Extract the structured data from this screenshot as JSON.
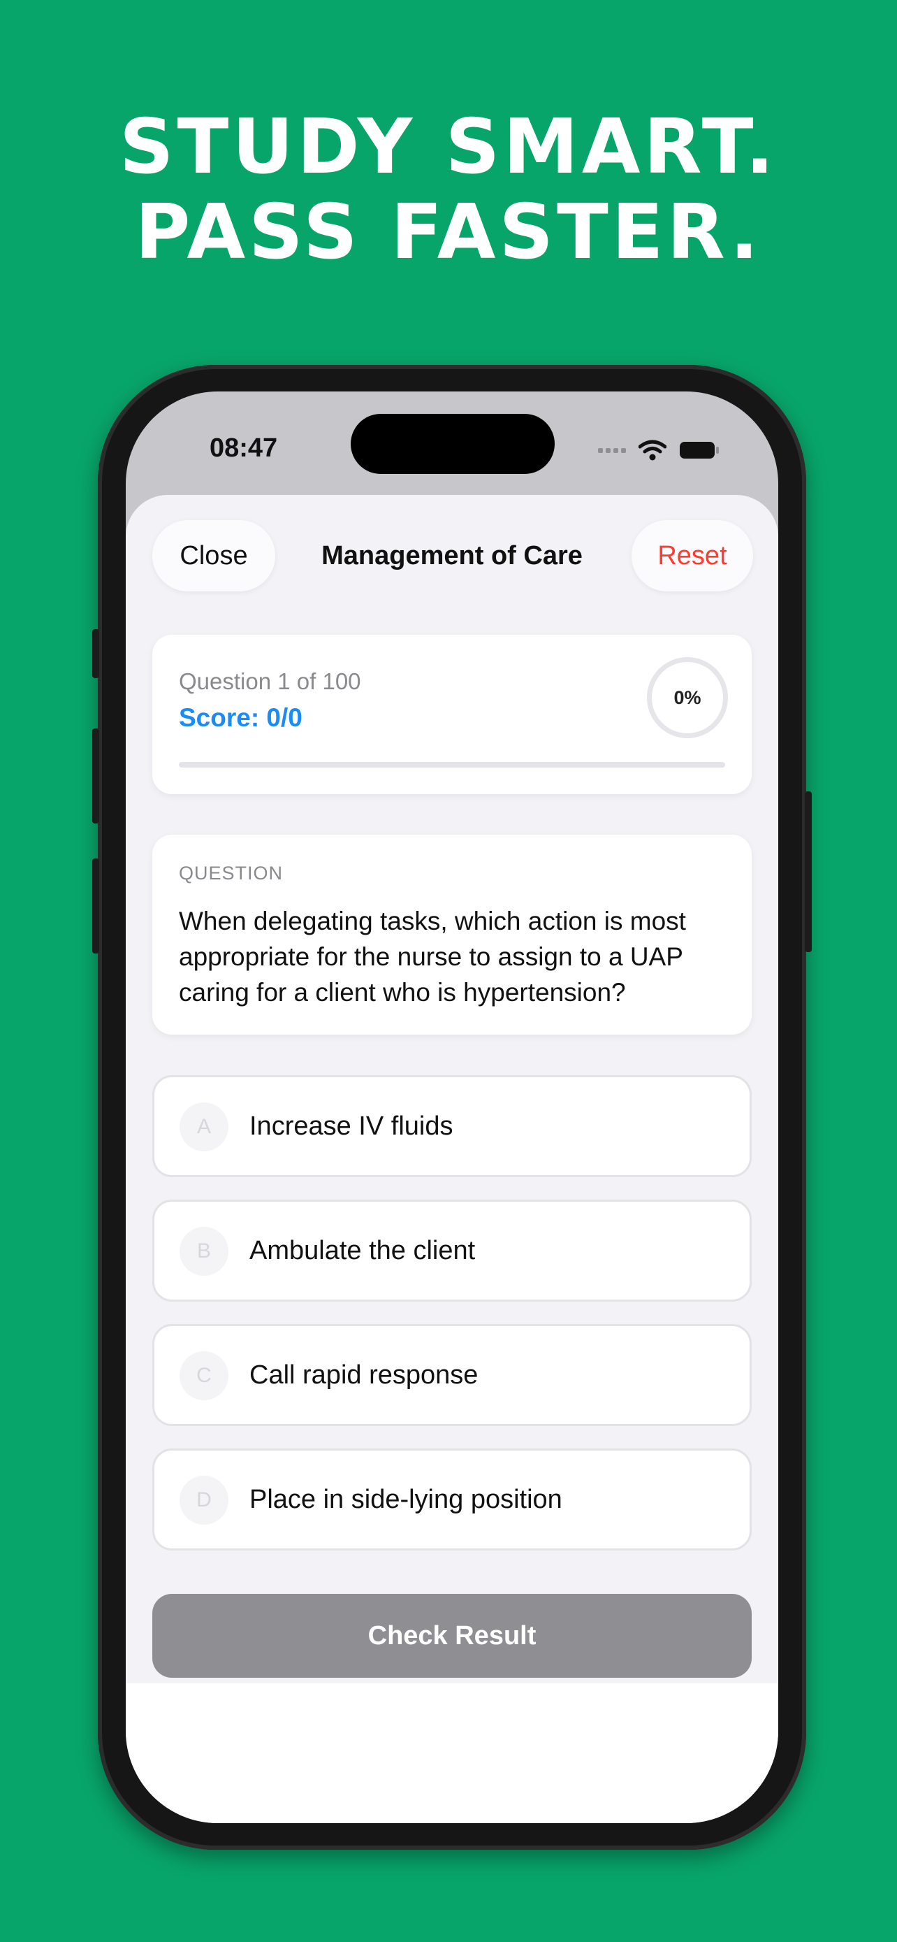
{
  "headline": {
    "line1": "STUDY SMART.",
    "line2": "PASS FASTER."
  },
  "status_bar": {
    "time": "08:47"
  },
  "nav": {
    "close_label": "Close",
    "title": "Management of Care",
    "reset_label": "Reset"
  },
  "progress": {
    "question_counter": "Question 1 of 100",
    "score": "Score: 0/0",
    "percent_label": "0%",
    "percent_value": 0
  },
  "question": {
    "section_label": "QUESTION",
    "text": "When delegating tasks, which action is most appropriate for the nurse to assign to a UAP caring for a client who is hypertension?"
  },
  "options": [
    {
      "letter": "A",
      "text": "Increase IV fluids"
    },
    {
      "letter": "B",
      "text": "Ambulate the client"
    },
    {
      "letter": "C",
      "text": "Call rapid response"
    },
    {
      "letter": "D",
      "text": "Place in side-lying position"
    }
  ],
  "check_button": {
    "label": "Check Result"
  },
  "colors": {
    "background": "#08a56a",
    "accent_blue": "#1a8cf5",
    "reset_red": "#ff3b30",
    "disabled_gray": "#8e8e93"
  }
}
